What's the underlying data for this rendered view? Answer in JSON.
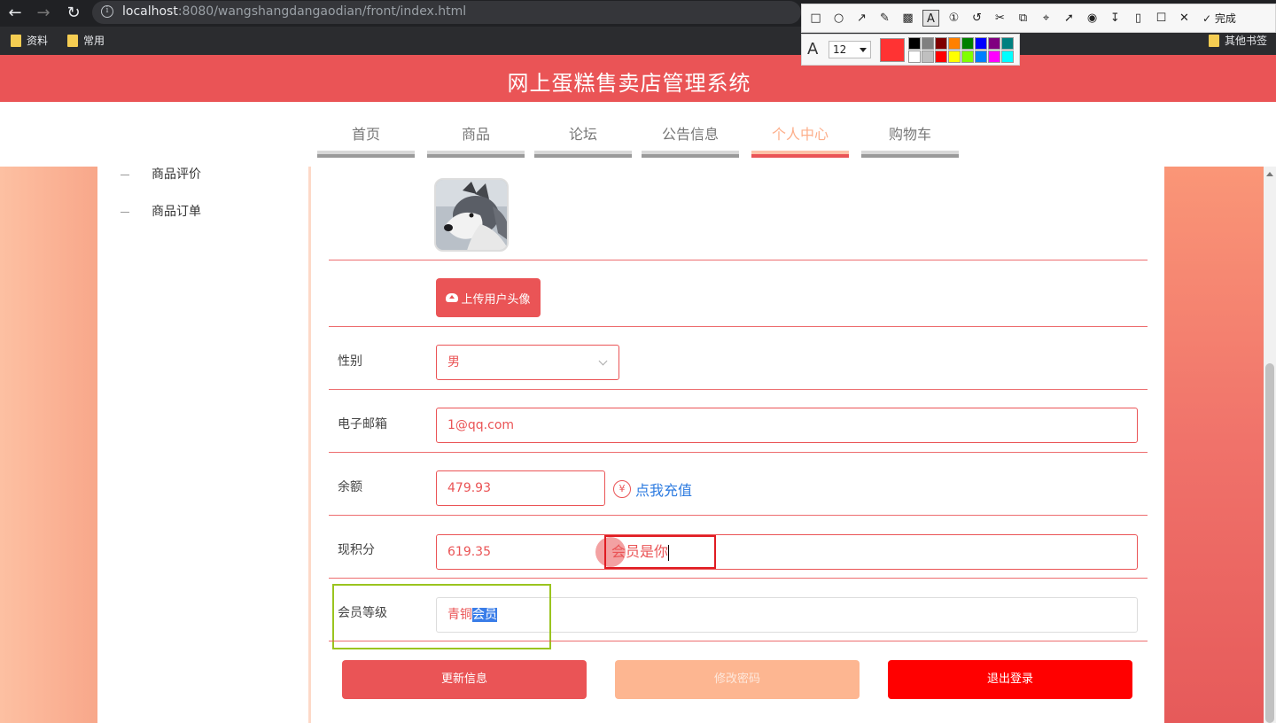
{
  "browser": {
    "url_host": "localhost",
    "url_rest": ":8080/wangshangdangaodian/front/index.html",
    "bookmarks": [
      "资料",
      "常用"
    ],
    "other_bookmarks": "其他书签"
  },
  "capture_tool": {
    "tools": [
      "rect-icon",
      "ellipse-icon",
      "arrow-icon",
      "pen-icon",
      "mosaic-icon",
      "text-icon",
      "number-icon",
      "undo-icon",
      "cut-icon",
      "copy-icon",
      "ocr-icon",
      "pin-icon",
      "record-icon",
      "download-icon",
      "save-icon",
      "bookmark-icon",
      "close-icon"
    ],
    "done_label": "完成",
    "font_size": "12",
    "current_color": "#ff3333",
    "palette": [
      "#000000",
      "#808080",
      "#7f0000",
      "#ff8000",
      "#008000",
      "#0000ff",
      "#800080",
      "#008080",
      "#ffffff",
      "#c0c0c0",
      "#ff0000",
      "#ffff00",
      "#80ff00",
      "#0080ff",
      "#ff00ff",
      "#00ffff"
    ]
  },
  "site": {
    "title": "网上蛋糕售卖店管理系统",
    "brand_color": "#ea5456"
  },
  "nav": {
    "tabs": [
      {
        "label": "首页",
        "active": false
      },
      {
        "label": "商品",
        "active": false
      },
      {
        "label": "论坛",
        "active": false
      },
      {
        "label": "公告信息",
        "active": false
      },
      {
        "label": "个人中心",
        "active": true
      },
      {
        "label": "购物车",
        "active": false
      }
    ]
  },
  "sidebar": {
    "items": [
      "商品评价",
      "商品订单"
    ]
  },
  "form": {
    "upload_label": "上传用户头像",
    "gender": {
      "label": "性别",
      "value": "男"
    },
    "email": {
      "label": "电子邮箱",
      "value": "1@qq.com"
    },
    "balance": {
      "label": "余额",
      "value": "479.93",
      "recharge_label": "点我充值",
      "yen": "¥"
    },
    "points": {
      "label": "现积分",
      "value": "619.35"
    },
    "level": {
      "label": "会员等级",
      "value_plain": "青铜",
      "value_selected": "会员"
    }
  },
  "annotation": {
    "typed_text": "会员是你"
  },
  "buttons": {
    "update": "更新信息",
    "change_password": "修改密码",
    "logout": "退出登录"
  }
}
